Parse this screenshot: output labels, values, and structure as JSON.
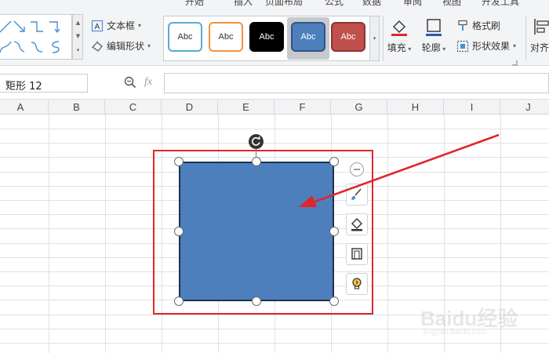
{
  "menubar": {
    "items": [
      {
        "label": "开始"
      },
      {
        "label": "插入"
      },
      {
        "label": "页面布局"
      },
      {
        "label": "公式"
      },
      {
        "label": "数据"
      },
      {
        "label": "审阅"
      },
      {
        "label": "视图"
      },
      {
        "label": "开发工具"
      }
    ]
  },
  "ribbon": {
    "text_box_label": "文本框",
    "edit_shape_label": "编辑形状",
    "style_swatches": [
      {
        "label": "Abc",
        "fill": "#ffffff",
        "border": "#5aaad0",
        "text_color": "#333333"
      },
      {
        "label": "Abc",
        "fill": "#ffffff",
        "border": "#f0943d",
        "text_color": "#333333"
      },
      {
        "label": "Abc",
        "fill": "#000000",
        "border": "#000000",
        "text_color": "#ffffff"
      },
      {
        "label": "Abc",
        "fill": "#4e7fbd",
        "border": "#2f5589",
        "text_color": "#ffffff",
        "selected": true
      },
      {
        "label": "Abc",
        "fill": "#c0504d",
        "border": "#8c3432",
        "text_color": "#ffffff"
      }
    ],
    "fill_label": "填充",
    "outline_label": "轮廓",
    "format_painter_label": "格式刷",
    "shape_effects_label": "形状效果",
    "align_label": "对齐"
  },
  "formula_bar": {
    "name_box": "矩形 12",
    "fx_label": "fx",
    "formula_value": ""
  },
  "sheet": {
    "columns": [
      "A",
      "B",
      "C",
      "D",
      "E",
      "F",
      "G",
      "H",
      "I",
      "J"
    ]
  },
  "colors": {
    "shape_fill": "#4e7fbd",
    "annotation_red": "#e0262b"
  },
  "watermark": {
    "logo": "Baidu经验",
    "url": "jingyan.baidu.com"
  }
}
